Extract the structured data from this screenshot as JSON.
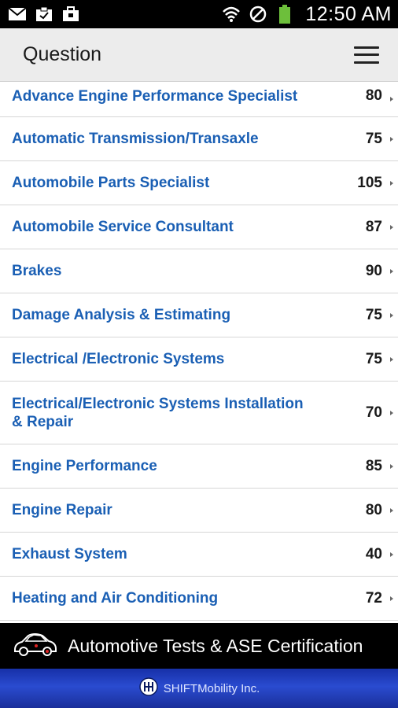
{
  "status_bar": {
    "time": "12:50 AM",
    "icons": [
      "email-icon",
      "clipboard-icon",
      "briefcase-icon",
      "wifi-icon",
      "do-not-disturb-icon",
      "battery-icon"
    ]
  },
  "header": {
    "title": "Question",
    "menu_icon": "hamburger-menu-icon"
  },
  "list": {
    "items": [
      {
        "label": "Advance Engine Performance Specialist",
        "count": "80"
      },
      {
        "label": "Automatic Transmission/Transaxle",
        "count": "75"
      },
      {
        "label": "Automobile Parts Specialist",
        "count": "105"
      },
      {
        "label": "Automobile Service Consultant",
        "count": "87"
      },
      {
        "label": "Brakes",
        "count": "90"
      },
      {
        "label": "Damage Analysis & Estimating",
        "count": "75"
      },
      {
        "label": "Electrical /Electronic Systems",
        "count": "75"
      },
      {
        "label": "Electrical/Electronic Systems Installation & Repair",
        "count": "70"
      },
      {
        "label": "Engine Performance",
        "count": "85"
      },
      {
        "label": "Engine Repair",
        "count": "80"
      },
      {
        "label": "Exhaust System",
        "count": "40"
      },
      {
        "label": "Heating and Air Conditioning",
        "count": "72"
      }
    ]
  },
  "banner": {
    "text": "Automotive Tests & ASE Certification",
    "icon": "car-icon"
  },
  "footer": {
    "text": "SHIFTMobility Inc.",
    "icon": "gear-shift-logo-icon"
  },
  "colors": {
    "link_blue": "#1a5fb4",
    "header_bg": "#ececec",
    "footer_blue": "#2a4bd0"
  }
}
